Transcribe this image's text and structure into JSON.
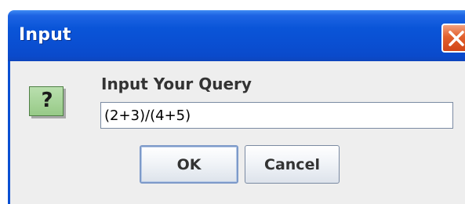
{
  "dialog": {
    "title": "Input",
    "icon": "question-icon",
    "icon_glyph": "?",
    "prompt": "Input Your Query",
    "input_value": "(2+3)/(4+5)",
    "ok_label": "OK",
    "cancel_label": "Cancel"
  },
  "colors": {
    "titlebar": "#0a4fd2",
    "close_button": "#e2602d",
    "body_background": "#eeeeee",
    "icon_background": "#a6d49a"
  }
}
